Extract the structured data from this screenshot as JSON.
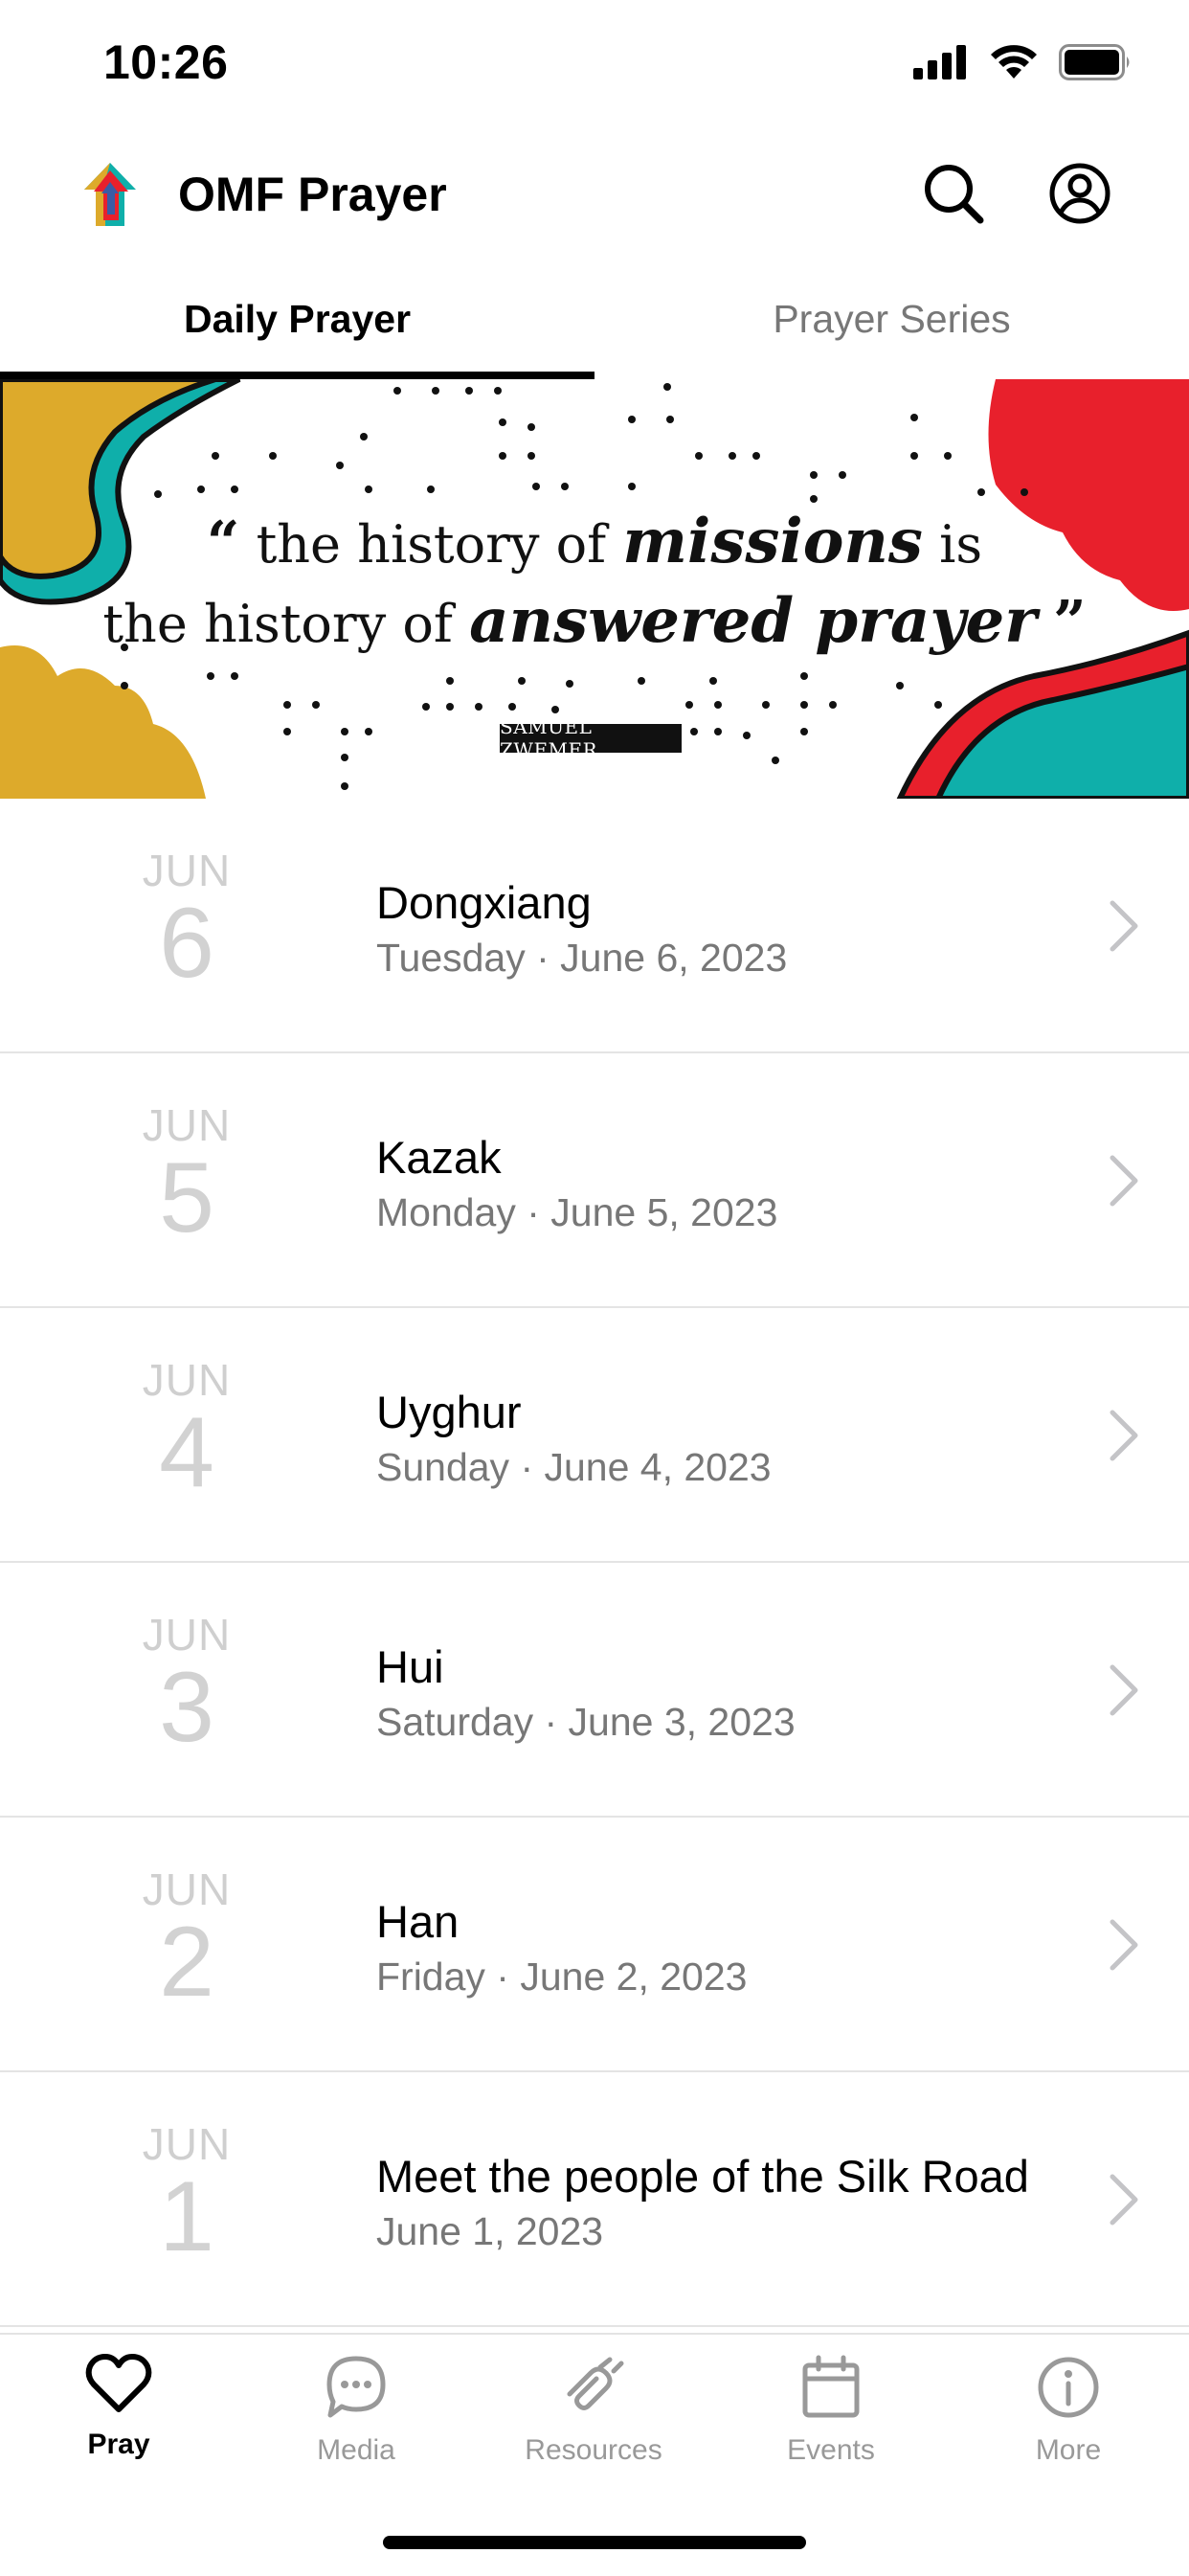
{
  "status_bar": {
    "time": "10:26"
  },
  "header": {
    "title": "OMF Prayer",
    "search_icon": "search-icon",
    "account_icon": "account-icon"
  },
  "tabs": [
    {
      "label": "Daily Prayer",
      "active": true
    },
    {
      "label": "Prayer Series",
      "active": false
    }
  ],
  "banner": {
    "open_quote": "“",
    "line1_pre": "the history of ",
    "line1_bold": "missions",
    "line1_post": " is",
    "line2_pre": "the history of ",
    "line2_bold": "answered prayer",
    "close_quote": "”",
    "author": "SAMUEL ZWEMER",
    "colors": {
      "gold": "#DDAA2B",
      "teal": "#0FAFAA",
      "red": "#E8202C"
    }
  },
  "prayers": [
    {
      "month": "JUN",
      "day": "6",
      "title": "Dongxiang",
      "subtitle": "Tuesday · June 6, 2023"
    },
    {
      "month": "JUN",
      "day": "5",
      "title": "Kazak",
      "subtitle": "Monday · June 5, 2023"
    },
    {
      "month": "JUN",
      "day": "4",
      "title": "Uyghur",
      "subtitle": "Sunday · June 4, 2023"
    },
    {
      "month": "JUN",
      "day": "3",
      "title": "Hui",
      "subtitle": "Saturday · June 3, 2023"
    },
    {
      "month": "JUN",
      "day": "2",
      "title": "Han",
      "subtitle": "Friday · June 2, 2023"
    },
    {
      "month": "JUN",
      "day": "1",
      "title": "Meet the people of the Silk Road",
      "subtitle": "June 1, 2023"
    }
  ],
  "tab_bar": [
    {
      "label": "Pray",
      "icon": "heart-icon",
      "active": true
    },
    {
      "label": "Media",
      "icon": "chat-bubble-icon",
      "active": false
    },
    {
      "label": "Resources",
      "icon": "resources-icon",
      "active": false
    },
    {
      "label": "Events",
      "icon": "calendar-icon",
      "active": false
    },
    {
      "label": "More",
      "icon": "info-icon",
      "active": false
    }
  ]
}
